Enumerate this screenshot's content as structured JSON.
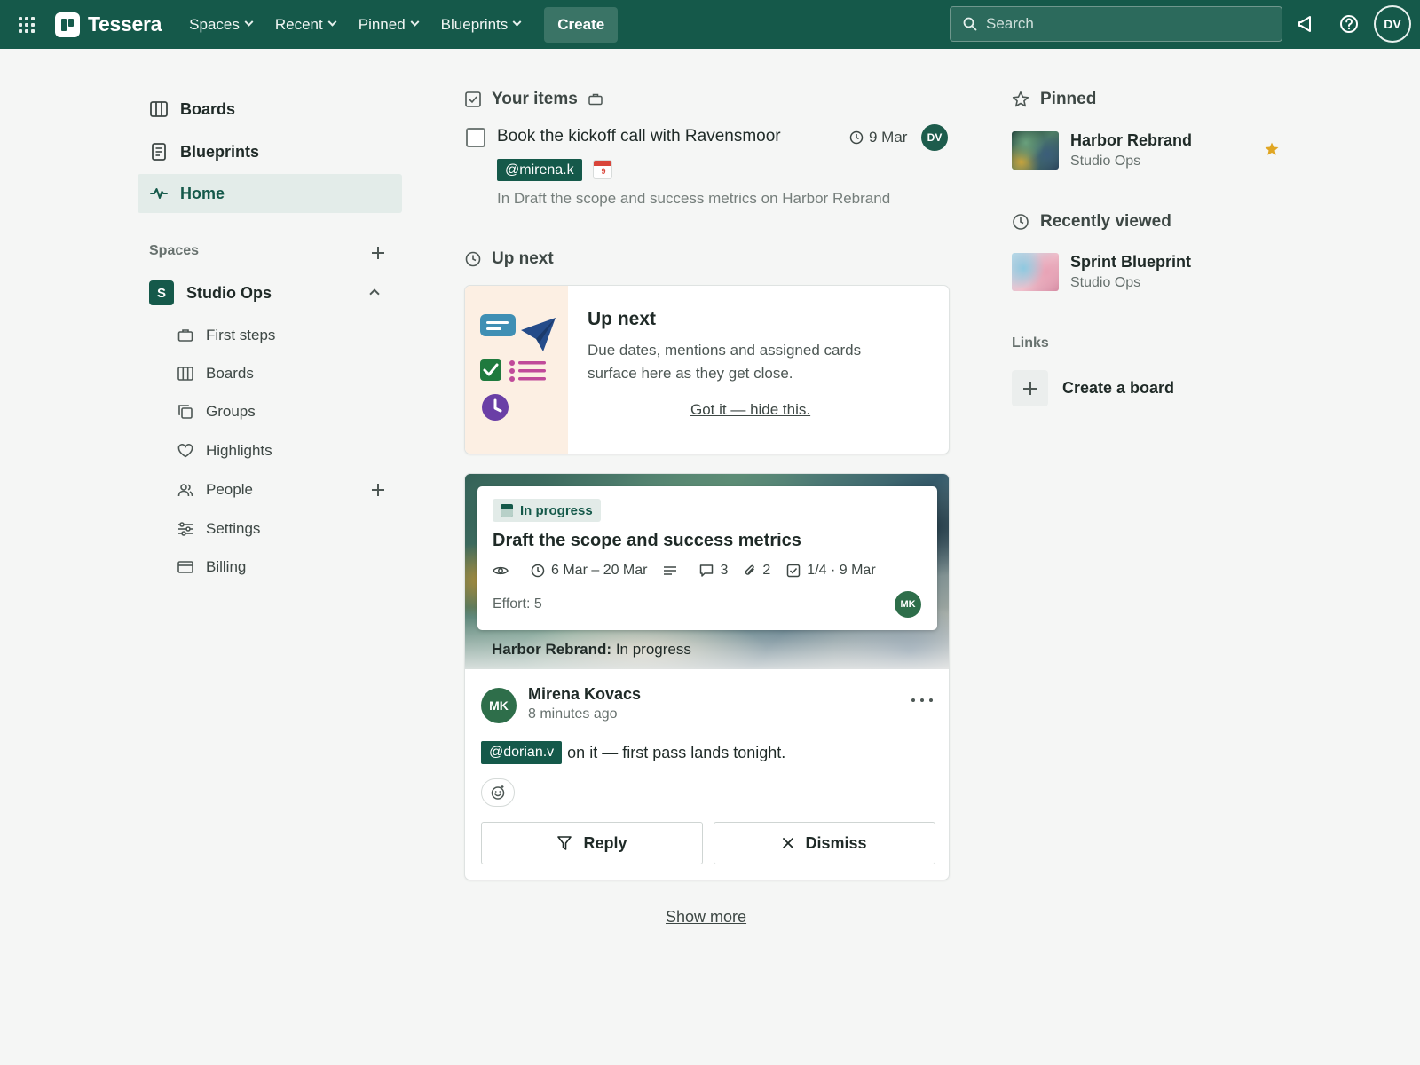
{
  "app": {
    "name": "Tessera"
  },
  "topnav": {
    "items": [
      {
        "label": "Spaces"
      },
      {
        "label": "Recent"
      },
      {
        "label": "Pinned"
      },
      {
        "label": "Blueprints"
      }
    ],
    "create_label": "Create",
    "search_placeholder": "Search",
    "avatar_initials": "DV"
  },
  "sidebar": {
    "links": [
      {
        "label": "Boards",
        "icon": "board-icon"
      },
      {
        "label": "Blueprints",
        "icon": "blueprint-icon"
      },
      {
        "label": "Home",
        "icon": "activity-icon",
        "active": true
      }
    ],
    "spaces_heading": "Spaces",
    "space": {
      "badge": "S",
      "name": "Studio Ops"
    },
    "sub_items": [
      {
        "label": "First steps",
        "icon": "briefcase-icon"
      },
      {
        "label": "Boards",
        "icon": "board-icon"
      },
      {
        "label": "Groups",
        "icon": "copy-icon"
      },
      {
        "label": "Highlights",
        "icon": "heart-icon"
      },
      {
        "label": "People",
        "icon": "people-icon"
      },
      {
        "label": "Settings",
        "icon": "sliders-icon"
      },
      {
        "label": "Billing",
        "icon": "card-icon"
      }
    ]
  },
  "your_items": {
    "title": "Your items",
    "task": {
      "title": "Book the kickoff call with Ravensmoor",
      "due": "9 Mar",
      "avatar": "DV",
      "mention": "@mirena.k",
      "calendar_day": "9",
      "subtitle": "In Draft the scope and success metrics on Harbor Rebrand"
    }
  },
  "up_next": {
    "section_title": "Up next",
    "card_title": "Up next",
    "card_text": "Due dates, mentions and assigned cards surface here as they get close.",
    "dismiss_link": "Got it — hide this."
  },
  "activity": {
    "status": "In progress",
    "card_title": "Draft the scope and success metrics",
    "date_range": "6 Mar – 20 Mar",
    "comments": "3",
    "attachments": "2",
    "checklist": "1/4 · 9 Mar",
    "effort": "Effort: 5",
    "member_initials": "MK",
    "board_caption_bold": "Harbor Rebrand:",
    "board_caption_rest": "In progress",
    "commenter_initials": "MK",
    "commenter_name": "Mirena Kovacs",
    "time_ago": "8 minutes ago",
    "comment_mention": "@dorian.v",
    "comment_text": "on it — first pass lands tonight.",
    "reply_label": "Reply",
    "dismiss_label": "Dismiss"
  },
  "show_more": "Show more",
  "right": {
    "pinned_title": "Pinned",
    "pinned": [
      {
        "name": "Harbor Rebrand",
        "space": "Studio Ops"
      }
    ],
    "recent_title": "Recently viewed",
    "recent": [
      {
        "name": "Sprint Blueprint",
        "space": "Studio Ops"
      }
    ],
    "links_title": "Links",
    "create_board": "Create a board"
  },
  "colors": {
    "brand": "#15594a",
    "accent_star": "#e0a623"
  }
}
